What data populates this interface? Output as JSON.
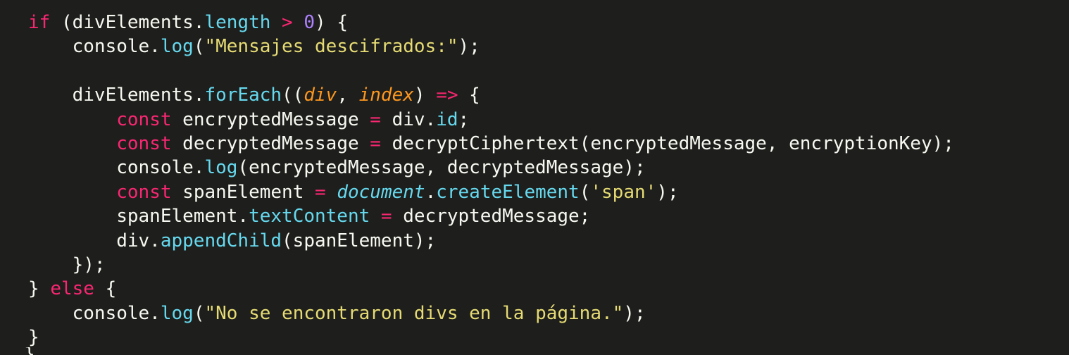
{
  "theme": {
    "background": "#1e1f1c",
    "colors": {
      "plain": "#f8f8f2",
      "keyword": "#f92672",
      "property": "#66d9ef",
      "string": "#e6db74",
      "number": "#ae81ff",
      "param": "#fd971f"
    }
  },
  "code": {
    "lines": [
      [
        {
          "t": "if",
          "k": "keyword"
        },
        {
          "t": " (divElements.",
          "k": "plain"
        },
        {
          "t": "length",
          "k": "property"
        },
        {
          "t": " ",
          "k": "plain"
        },
        {
          "t": ">",
          "k": "operator"
        },
        {
          "t": " ",
          "k": "plain"
        },
        {
          "t": "0",
          "k": "number"
        },
        {
          "t": ") {",
          "k": "plain"
        }
      ],
      [
        {
          "t": "    console.",
          "k": "plain"
        },
        {
          "t": "log",
          "k": "property"
        },
        {
          "t": "(",
          "k": "plain"
        },
        {
          "t": "\"Mensajes descifrados:\"",
          "k": "string"
        },
        {
          "t": ");",
          "k": "plain"
        }
      ],
      [],
      [
        {
          "t": "    divElements.",
          "k": "plain"
        },
        {
          "t": "forEach",
          "k": "property"
        },
        {
          "t": "((",
          "k": "plain"
        },
        {
          "t": "div",
          "k": "param"
        },
        {
          "t": ", ",
          "k": "plain"
        },
        {
          "t": "index",
          "k": "param"
        },
        {
          "t": ") ",
          "k": "plain"
        },
        {
          "t": "=>",
          "k": "storage"
        },
        {
          "t": " {",
          "k": "plain"
        }
      ],
      [
        {
          "t": "        ",
          "k": "plain"
        },
        {
          "t": "const",
          "k": "storage"
        },
        {
          "t": " encryptedMessage ",
          "k": "plain"
        },
        {
          "t": "=",
          "k": "operator"
        },
        {
          "t": " div.",
          "k": "plain"
        },
        {
          "t": "id",
          "k": "property"
        },
        {
          "t": ";",
          "k": "plain"
        }
      ],
      [
        {
          "t": "        ",
          "k": "plain"
        },
        {
          "t": "const",
          "k": "storage"
        },
        {
          "t": " decryptedMessage ",
          "k": "plain"
        },
        {
          "t": "=",
          "k": "operator"
        },
        {
          "t": " decryptCiphertext(encryptedMessage, encryptionKey);",
          "k": "plain"
        }
      ],
      [
        {
          "t": "        console.",
          "k": "plain"
        },
        {
          "t": "log",
          "k": "property"
        },
        {
          "t": "(encryptedMessage, decryptedMessage);",
          "k": "plain"
        }
      ],
      [
        {
          "t": "        ",
          "k": "plain"
        },
        {
          "t": "const",
          "k": "storage"
        },
        {
          "t": " spanElement ",
          "k": "plain"
        },
        {
          "t": "=",
          "k": "operator"
        },
        {
          "t": " ",
          "k": "plain"
        },
        {
          "t": "document",
          "k": "global"
        },
        {
          "t": ".",
          "k": "plain"
        },
        {
          "t": "createElement",
          "k": "property"
        },
        {
          "t": "(",
          "k": "plain"
        },
        {
          "t": "'span'",
          "k": "string"
        },
        {
          "t": ");",
          "k": "plain"
        }
      ],
      [
        {
          "t": "        spanElement.",
          "k": "plain"
        },
        {
          "t": "textContent",
          "k": "property"
        },
        {
          "t": " ",
          "k": "plain"
        },
        {
          "t": "=",
          "k": "operator"
        },
        {
          "t": " decryptedMessage;",
          "k": "plain"
        }
      ],
      [
        {
          "t": "        div.",
          "k": "plain"
        },
        {
          "t": "appendChild",
          "k": "property"
        },
        {
          "t": "(spanElement);",
          "k": "plain"
        }
      ],
      [
        {
          "t": "    });",
          "k": "plain"
        }
      ],
      [
        {
          "t": "} ",
          "k": "plain"
        },
        {
          "t": "else",
          "k": "keyword"
        },
        {
          "t": " {",
          "k": "plain"
        }
      ],
      [
        {
          "t": "    console.",
          "k": "plain"
        },
        {
          "t": "log",
          "k": "property"
        },
        {
          "t": "(",
          "k": "plain"
        },
        {
          "t": "\"No se encontraron divs en la página.\"",
          "k": "string"
        },
        {
          "t": ");",
          "k": "plain"
        }
      ],
      [
        {
          "t": "}",
          "k": "plain"
        }
      ]
    ]
  },
  "edge_mark": "}"
}
